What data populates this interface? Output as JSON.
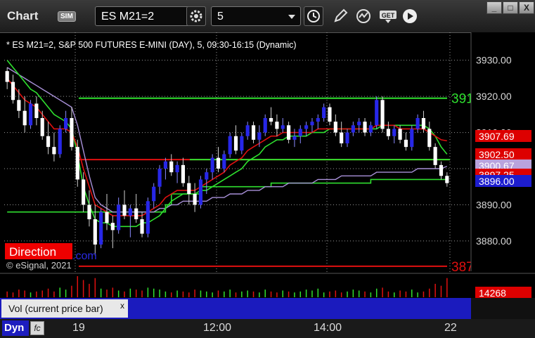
{
  "window": {
    "title": "Chart",
    "sim_badge": "SIM",
    "symbol_value": "ES M21=2",
    "interval_value": "5",
    "buttons": {
      "minimize": "_",
      "restore": "□",
      "close": "X"
    }
  },
  "chart": {
    "header": "* ES M21=2, S&P 500 FUTURES E-MINI (DAY), 5, 09:30-16:15 (Dynamic)",
    "watermark": "© eSignal, 2021",
    "direction_label": "Direction",
    "direction_suffix": ".com",
    "price_axis": {
      "ticks": [
        "3930.00",
        "3920.00",
        "3910.00",
        "3900.00",
        "3890.00",
        "3880.00"
      ],
      "tick_values": [
        3930,
        3920,
        3910,
        3900,
        3890,
        3880
      ],
      "range": [
        3872,
        3935
      ]
    },
    "level_lines": [
      {
        "price": 3919.5,
        "color": "#2fe02f",
        "label": "391"
      },
      {
        "price": 3902.5,
        "color": "#e01010",
        "label": ""
      },
      {
        "price": 3902.5,
        "color": "#2fe02f",
        "label": ""
      },
      {
        "price": 3873.0,
        "color": "#e01010",
        "label": "387"
      }
    ],
    "price_badges": [
      {
        "text": "3907.69",
        "bg": "#dd0000",
        "fg": "#ffffff"
      },
      {
        "text": "3902.50",
        "bg": "#dd0000",
        "fg": "#ffffff"
      },
      {
        "text": "3900.67",
        "bg": "#b9a3dd",
        "fg": "#ffffff"
      },
      {
        "text": "3897.25",
        "bg": "#dd0000",
        "fg": "#ffffff"
      },
      {
        "text": "3896.00",
        "bg": "#1d1dcf",
        "fg": "#ffffff"
      }
    ],
    "candles": [
      [
        3927,
        3928,
        3922,
        3924
      ],
      [
        3924,
        3926,
        3918,
        3919
      ],
      [
        3919,
        3922,
        3914,
        3916
      ],
      [
        3916,
        3920,
        3910,
        3912
      ],
      [
        3912,
        3919,
        3911,
        3918
      ],
      [
        3918,
        3920,
        3912,
        3914
      ],
      [
        3914,
        3916,
        3908,
        3909
      ],
      [
        3909,
        3913,
        3904,
        3906
      ],
      [
        3906,
        3910,
        3902,
        3904
      ],
      [
        3904,
        3912,
        3903,
        3911
      ],
      [
        3911,
        3916,
        3910,
        3914
      ],
      [
        3914,
        3917,
        3905,
        3906
      ],
      [
        3906,
        3908,
        3895,
        3897
      ],
      [
        3897,
        3899,
        3888,
        3890
      ],
      [
        3890,
        3894,
        3884,
        3886
      ],
      [
        3886,
        3890,
        3876,
        3879
      ],
      [
        3879,
        3889,
        3878,
        3888
      ],
      [
        3888,
        3893,
        3883,
        3885
      ],
      [
        3885,
        3887,
        3878,
        3883
      ],
      [
        3883,
        3892,
        3882,
        3890
      ],
      [
        3890,
        3894,
        3886,
        3887
      ],
      [
        3887,
        3890,
        3881,
        3889
      ],
      [
        3889,
        3893,
        3885,
        3886
      ],
      [
        3886,
        3888,
        3881,
        3882
      ],
      [
        3882,
        3892,
        3881,
        3891
      ],
      [
        3891,
        3896,
        3889,
        3895
      ],
      [
        3895,
        3901,
        3893,
        3900
      ],
      [
        3900,
        3903,
        3897,
        3902
      ],
      [
        3902,
        3904,
        3898,
        3899
      ],
      [
        3899,
        3902,
        3896,
        3901
      ],
      [
        3901,
        3903,
        3895,
        3896
      ],
      [
        3896,
        3898,
        3890,
        3893
      ],
      [
        3893,
        3896,
        3888,
        3890
      ],
      [
        3890,
        3898,
        3889,
        3897
      ],
      [
        3897,
        3900,
        3893,
        3899
      ],
      [
        3899,
        3904,
        3897,
        3903
      ],
      [
        3903,
        3906,
        3899,
        3900
      ],
      [
        3900,
        3905,
        3899,
        3904
      ],
      [
        3904,
        3910,
        3903,
        3909
      ],
      [
        3909,
        3912,
        3904,
        3905
      ],
      [
        3905,
        3910,
        3904,
        3909
      ],
      [
        3909,
        3913,
        3908,
        3912
      ],
      [
        3912,
        3913,
        3907,
        3908
      ],
      [
        3908,
        3912,
        3906,
        3910
      ],
      [
        3910,
        3915,
        3909,
        3914
      ],
      [
        3914,
        3917,
        3912,
        3913
      ],
      [
        3913,
        3915,
        3909,
        3911
      ],
      [
        3911,
        3914,
        3910,
        3912
      ],
      [
        3912,
        3913,
        3907,
        3908
      ],
      [
        3908,
        3911,
        3906,
        3909
      ],
      [
        3909,
        3912,
        3907,
        3911
      ],
      [
        3911,
        3913,
        3909,
        3912
      ],
      [
        3912,
        3914,
        3910,
        3913
      ],
      [
        3913,
        3915,
        3911,
        3914
      ],
      [
        3914,
        3918,
        3913,
        3917
      ],
      [
        3917,
        3918,
        3912,
        3913
      ],
      [
        3913,
        3915,
        3909,
        3910
      ],
      [
        3910,
        3913,
        3906,
        3907
      ],
      [
        3907,
        3911,
        3906,
        3910
      ],
      [
        3910,
        3913,
        3909,
        3912
      ],
      [
        3912,
        3914,
        3910,
        3913
      ],
      [
        3913,
        3914,
        3909,
        3910
      ],
      [
        3910,
        3913,
        3909,
        3912
      ],
      [
        3912,
        3920,
        3911,
        3919
      ],
      [
        3919,
        3920,
        3910,
        3911
      ],
      [
        3911,
        3913,
        3908,
        3909
      ],
      [
        3909,
        3912,
        3907,
        3911
      ],
      [
        3911,
        3912,
        3907,
        3908
      ],
      [
        3908,
        3910,
        3905,
        3906
      ],
      [
        3906,
        3912,
        3905,
        3911
      ],
      [
        3911,
        3915,
        3910,
        3914
      ],
      [
        3914,
        3916,
        3910,
        3911
      ],
      [
        3911,
        3913,
        3905,
        3906
      ],
      [
        3906,
        3907,
        3900,
        3901
      ],
      [
        3901,
        3902,
        3897,
        3898
      ],
      [
        3898,
        3899,
        3895,
        3896
      ]
    ],
    "red_avg": [
      3925,
      3923,
      3921,
      3919,
      3918,
      3917,
      3915,
      3913,
      3911,
      3911,
      3911,
      3910,
      3906,
      3900,
      3895,
      3890,
      3889,
      3888,
      3887,
      3887,
      3887,
      3887,
      3887,
      3887,
      3888,
      3889,
      3890,
      3892,
      3893,
      3894,
      3894,
      3894,
      3894,
      3895,
      3896,
      3897,
      3898,
      3899,
      3901,
      3902,
      3903,
      3905,
      3906,
      3907,
      3908,
      3909,
      3909,
      3910,
      3910,
      3910,
      3910,
      3910,
      3910,
      3911,
      3911,
      3911,
      3911,
      3911,
      3911,
      3911,
      3911,
      3911,
      3911,
      3912,
      3912,
      3912,
      3912,
      3911,
      3911,
      3911,
      3911,
      3911,
      3910,
      3909,
      3908,
      3907.7
    ],
    "green_avg": [
      3930,
      3928,
      3926,
      3924,
      3922,
      3921,
      3919,
      3917,
      3915,
      3914,
      3913,
      3911,
      3904,
      3895,
      3890,
      3886,
      3885,
      3885,
      3884,
      3884,
      3884,
      3884,
      3884,
      3885,
      3885,
      3886,
      3887,
      3889,
      3891,
      3892,
      3893,
      3893,
      3893,
      3894,
      3894,
      3895,
      3896,
      3897,
      3898,
      3899,
      3900,
      3902,
      3903,
      3904,
      3906,
      3907,
      3908,
      3908,
      3909,
      3909,
      3909,
      3909,
      3910,
      3910,
      3910,
      3911,
      3911,
      3911,
      3911,
      3911,
      3911,
      3911,
      3911,
      3911,
      3912,
      3912,
      3912,
      3912,
      3912,
      3912,
      3912,
      3912,
      3911,
      3909,
      3906,
      3904
    ],
    "vwap": [
      3928,
      3927,
      3926,
      3925,
      3924,
      3923,
      3922,
      3921,
      3920,
      3919,
      3918,
      3917,
      3912,
      3905,
      3898,
      3892,
      3890,
      3889,
      3888,
      3888,
      3888,
      3888,
      3888,
      3888,
      3888,
      3888,
      3889,
      3889,
      3890,
      3890,
      3891,
      3891,
      3891,
      3891,
      3891,
      3892,
      3892,
      3892,
      3893,
      3893,
      3893,
      3894,
      3894,
      3894,
      3895,
      3895,
      3895,
      3895,
      3896,
      3896,
      3896,
      3896,
      3896,
      3897,
      3897,
      3897,
      3897,
      3898,
      3898,
      3898,
      3898,
      3898,
      3898,
      3899,
      3899,
      3899,
      3899,
      3899,
      3899,
      3899,
      3900,
      3900,
      3900,
      3900,
      3900,
      3900.67
    ],
    "support_steps": [
      3888,
      3888,
      3888,
      3888,
      3888,
      3888,
      3888,
      3888,
      3888,
      3888,
      3888,
      3888,
      3888,
      3888,
      3888,
      3888,
      3888,
      3888,
      3888,
      3888,
      3888,
      3888,
      3888,
      3888,
      3888,
      3888,
      3888,
      3890,
      3893,
      3893,
      3893,
      3893,
      3893,
      3895,
      3895,
      3895,
      3895,
      3895,
      3895,
      3895,
      3895,
      3895,
      3895,
      3895,
      3895,
      3896,
      3896,
      3896,
      3896,
      3896,
      3896,
      3896,
      3896,
      3896,
      3896,
      3896,
      3896,
      3896,
      3896,
      3896,
      3896,
      3896,
      3897,
      3897,
      3897,
      3897,
      3897,
      3897,
      3897,
      3897,
      3897,
      3897,
      3897,
      3897,
      3897,
      3897
    ]
  },
  "volume": {
    "label": "Vol (current price bar)",
    "badge": "14268",
    "close_glyph": "x",
    "bars": [
      6,
      5,
      8,
      7,
      5,
      6,
      7,
      9,
      6,
      10,
      8,
      12,
      22,
      18,
      14,
      20,
      9,
      8,
      10,
      7,
      6,
      9,
      8,
      7,
      10,
      9,
      8,
      6,
      5,
      7,
      6,
      5,
      8,
      7,
      6,
      5,
      7,
      6,
      8,
      5,
      6,
      7,
      6,
      5,
      8,
      6,
      5,
      7,
      6,
      5,
      6,
      8,
      7,
      9,
      5,
      6,
      7,
      5,
      6,
      8,
      7,
      6,
      5,
      9,
      10,
      6,
      5,
      7,
      6,
      8,
      5,
      6,
      9,
      14,
      12,
      20
    ],
    "bar_colors": [
      "#2fe02f",
      "#e01010"
    ]
  },
  "time_axis": {
    "labels": [
      "19",
      "12:00",
      "14:00",
      "22"
    ],
    "dyn_label": "Dyn",
    "fx_glyph": "fc"
  },
  "colors": {
    "bull": "#2727e8",
    "bear": "#ffffff",
    "red_avg": "#e01010",
    "green_avg": "#2fe02f",
    "vwap": "#a890d8",
    "grid": "#9a9a9a"
  }
}
